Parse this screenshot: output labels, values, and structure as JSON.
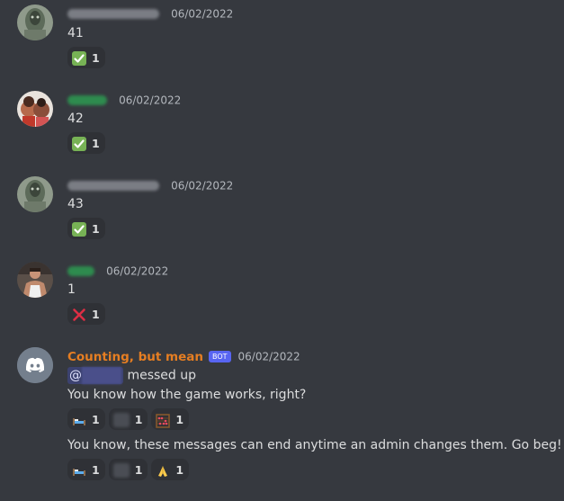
{
  "colors": {
    "background": "#36393f",
    "message_text": "#dcddde",
    "timestamp": "#b3b7bd",
    "bot_name": "#e67e22",
    "green_name": "#2ecc71",
    "bot_tag_bg": "#5865f2",
    "reaction_bg": "#2f3136",
    "mention_bg": "#3c4270"
  },
  "messages": [
    {
      "timestamp": "06/02/2022",
      "text": "41",
      "reactions": [
        {
          "emoji": "check-mark-icon",
          "count": "1"
        }
      ]
    },
    {
      "timestamp": "06/02/2022",
      "text": "42",
      "reactions": [
        {
          "emoji": "check-mark-icon",
          "count": "1"
        }
      ]
    },
    {
      "timestamp": "06/02/2022",
      "text": "43",
      "reactions": [
        {
          "emoji": "check-mark-icon",
          "count": "1"
        }
      ]
    },
    {
      "timestamp": "06/02/2022",
      "text": "1",
      "reactions": [
        {
          "emoji": "cross-mark-icon",
          "count": "1"
        }
      ]
    },
    {
      "author": "Counting, but mean",
      "bot_tag": "BOT",
      "timestamp": "06/02/2022",
      "mention_prefix": "@",
      "line1_suffix": "messed up",
      "line2": "You know how the game works, right?",
      "reactions1": [
        {
          "emoji": "bed-icon",
          "count": "1"
        },
        {
          "emoji": "custom-emoji-icon",
          "count": "1"
        },
        {
          "emoji": "abacus-icon",
          "count": "1"
        }
      ],
      "line3": "You know, these messages can end anytime an admin changes them. Go beg!",
      "reactions2": [
        {
          "emoji": "bed-icon",
          "count": "1"
        },
        {
          "emoji": "custom-emoji-icon",
          "count": "1"
        },
        {
          "emoji": "folded-hands-icon",
          "count": "1"
        }
      ]
    }
  ]
}
